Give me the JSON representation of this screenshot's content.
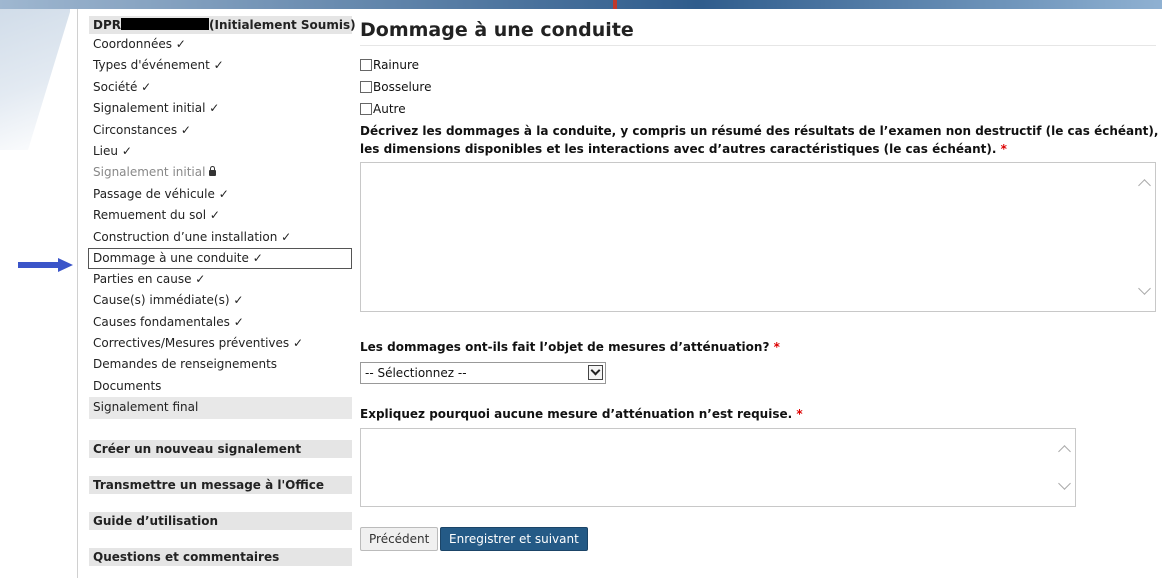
{
  "colors": {
    "primary": "#245a86",
    "required": "#dd0000",
    "arrow": "#3b55c9"
  },
  "sidebar": {
    "title_prefix": "DPR",
    "title_status": "(Initialement Soumis)",
    "items": [
      {
        "label": "Coordonnées ✓"
      },
      {
        "label": "Types d'événement ✓"
      },
      {
        "label": "Société ✓"
      },
      {
        "label": "Signalement initial ✓"
      },
      {
        "label": "Circonstances ✓"
      },
      {
        "label": "Lieu ✓"
      },
      {
        "label": "Signalement initial"
      },
      {
        "label": "Passage de véhicule ✓"
      },
      {
        "label": "Remuement du sol ✓"
      },
      {
        "label": "Construction d’une installation ✓"
      },
      {
        "label": "Dommage à une conduite ✓"
      },
      {
        "label": "Parties en cause ✓"
      },
      {
        "label": "Cause(s) immédiate(s) ✓"
      },
      {
        "label": "Causes fondamentales ✓"
      },
      {
        "label": "Correctives/Mesures préventives ✓"
      },
      {
        "label": "Demandes de renseignements"
      },
      {
        "label": "Documents"
      },
      {
        "label": "Signalement final"
      }
    ],
    "sections": [
      {
        "label": "Créer un nouveau signalement"
      },
      {
        "label": "Transmettre un message à l'Office"
      },
      {
        "label": "Guide d’utilisation"
      },
      {
        "label": "Questions et commentaires"
      }
    ]
  },
  "main": {
    "title": "Dommage à une conduite",
    "checkboxes": [
      {
        "label": "Rainure",
        "checked": false
      },
      {
        "label": "Bosselure",
        "checked": false
      },
      {
        "label": "Autre",
        "checked": false
      }
    ],
    "q1": "Décrivez les dommages à la conduite, y compris un résumé des résultats de l’examen non destructif (le cas échéant), les dimensions disponibles et les interactions avec d’autres caractéristiques (le cas échéant).",
    "q2": "Les dommages ont-ils fait l’objet de mesures d’atténuation?",
    "select_value": "-- Sélectionnez --",
    "q3": "Expliquez pourquoi aucune mesure d’atténuation n’est requise.",
    "required_mark": "*",
    "prev_button": "Précédent",
    "next_button": "Enregistrer et suivant"
  }
}
